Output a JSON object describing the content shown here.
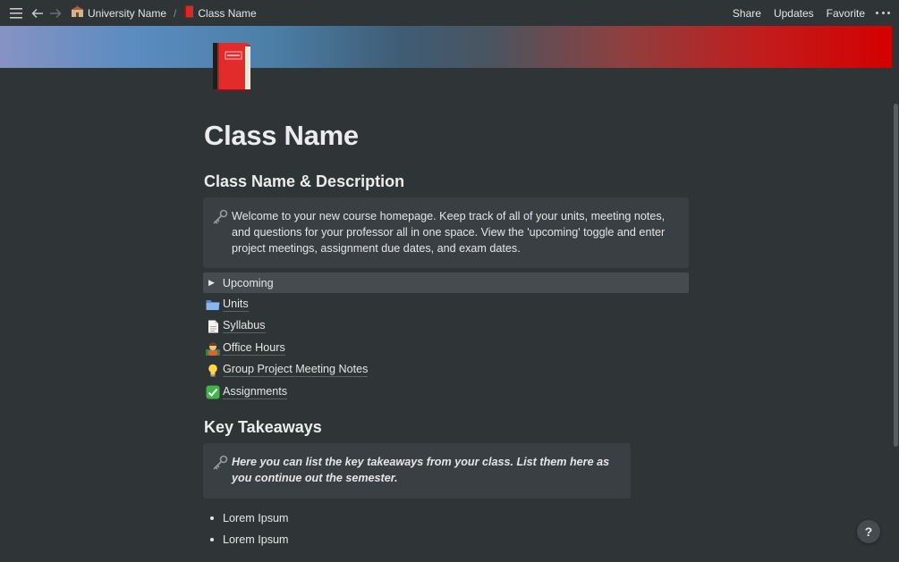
{
  "topbar": {
    "breadcrumbs": [
      {
        "icon": "school-icon",
        "label": "University Name"
      },
      {
        "icon": "red-book-icon",
        "label": "Class Name"
      }
    ],
    "separator": "/",
    "share": "Share",
    "updates": "Updates",
    "favorite": "Favorite"
  },
  "page": {
    "title": "Class Name"
  },
  "section1": {
    "heading": "Class Name & Description",
    "callout": "Welcome to your new course homepage. Keep track of all of your units, meeting notes, and questions for your professor all in one space. View the 'upcoming' toggle and enter project meetings, assignment due dates, and exam dates."
  },
  "toggle": {
    "label": "Upcoming"
  },
  "links": [
    {
      "icon": "folder-icon",
      "label": "Units"
    },
    {
      "icon": "document-icon",
      "label": "Syllabus"
    },
    {
      "icon": "teacher-icon",
      "label": "Office Hours"
    },
    {
      "icon": "lightbulb-icon",
      "label": "Group Project Meeting Notes"
    },
    {
      "icon": "check-mark-icon",
      "label": "Assignments"
    }
  ],
  "section2": {
    "heading": "Key Takeaways",
    "callout": "Here you can list the key takeaways from your class. List them here as you continue out the semester."
  },
  "bullets": [
    "Lorem Ipsum",
    "Lorem Ipsum"
  ],
  "help": "?",
  "colors": {
    "background": "#2f3437",
    "callout_bg": "#3a3f43",
    "toggle_bg": "#454b4e",
    "cover_accent": "#d40000"
  }
}
